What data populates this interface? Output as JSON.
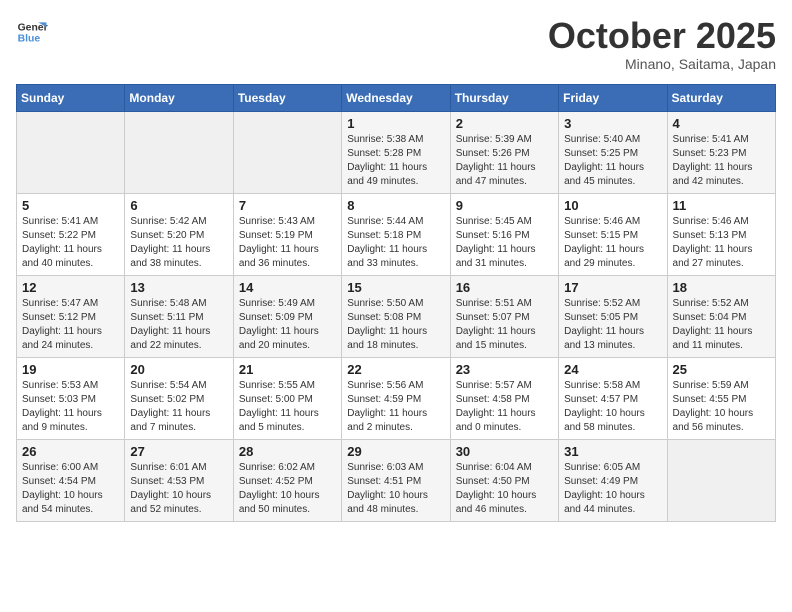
{
  "header": {
    "logo_line1": "General",
    "logo_line2": "Blue",
    "month_title": "October 2025",
    "location": "Minano, Saitama, Japan"
  },
  "weekdays": [
    "Sunday",
    "Monday",
    "Tuesday",
    "Wednesday",
    "Thursday",
    "Friday",
    "Saturday"
  ],
  "weeks": [
    [
      {
        "day": "",
        "info": ""
      },
      {
        "day": "",
        "info": ""
      },
      {
        "day": "",
        "info": ""
      },
      {
        "day": "1",
        "info": "Sunrise: 5:38 AM\nSunset: 5:28 PM\nDaylight: 11 hours\nand 49 minutes."
      },
      {
        "day": "2",
        "info": "Sunrise: 5:39 AM\nSunset: 5:26 PM\nDaylight: 11 hours\nand 47 minutes."
      },
      {
        "day": "3",
        "info": "Sunrise: 5:40 AM\nSunset: 5:25 PM\nDaylight: 11 hours\nand 45 minutes."
      },
      {
        "day": "4",
        "info": "Sunrise: 5:41 AM\nSunset: 5:23 PM\nDaylight: 11 hours\nand 42 minutes."
      }
    ],
    [
      {
        "day": "5",
        "info": "Sunrise: 5:41 AM\nSunset: 5:22 PM\nDaylight: 11 hours\nand 40 minutes."
      },
      {
        "day": "6",
        "info": "Sunrise: 5:42 AM\nSunset: 5:20 PM\nDaylight: 11 hours\nand 38 minutes."
      },
      {
        "day": "7",
        "info": "Sunrise: 5:43 AM\nSunset: 5:19 PM\nDaylight: 11 hours\nand 36 minutes."
      },
      {
        "day": "8",
        "info": "Sunrise: 5:44 AM\nSunset: 5:18 PM\nDaylight: 11 hours\nand 33 minutes."
      },
      {
        "day": "9",
        "info": "Sunrise: 5:45 AM\nSunset: 5:16 PM\nDaylight: 11 hours\nand 31 minutes."
      },
      {
        "day": "10",
        "info": "Sunrise: 5:46 AM\nSunset: 5:15 PM\nDaylight: 11 hours\nand 29 minutes."
      },
      {
        "day": "11",
        "info": "Sunrise: 5:46 AM\nSunset: 5:13 PM\nDaylight: 11 hours\nand 27 minutes."
      }
    ],
    [
      {
        "day": "12",
        "info": "Sunrise: 5:47 AM\nSunset: 5:12 PM\nDaylight: 11 hours\nand 24 minutes."
      },
      {
        "day": "13",
        "info": "Sunrise: 5:48 AM\nSunset: 5:11 PM\nDaylight: 11 hours\nand 22 minutes."
      },
      {
        "day": "14",
        "info": "Sunrise: 5:49 AM\nSunset: 5:09 PM\nDaylight: 11 hours\nand 20 minutes."
      },
      {
        "day": "15",
        "info": "Sunrise: 5:50 AM\nSunset: 5:08 PM\nDaylight: 11 hours\nand 18 minutes."
      },
      {
        "day": "16",
        "info": "Sunrise: 5:51 AM\nSunset: 5:07 PM\nDaylight: 11 hours\nand 15 minutes."
      },
      {
        "day": "17",
        "info": "Sunrise: 5:52 AM\nSunset: 5:05 PM\nDaylight: 11 hours\nand 13 minutes."
      },
      {
        "day": "18",
        "info": "Sunrise: 5:52 AM\nSunset: 5:04 PM\nDaylight: 11 hours\nand 11 minutes."
      }
    ],
    [
      {
        "day": "19",
        "info": "Sunrise: 5:53 AM\nSunset: 5:03 PM\nDaylight: 11 hours\nand 9 minutes."
      },
      {
        "day": "20",
        "info": "Sunrise: 5:54 AM\nSunset: 5:02 PM\nDaylight: 11 hours\nand 7 minutes."
      },
      {
        "day": "21",
        "info": "Sunrise: 5:55 AM\nSunset: 5:00 PM\nDaylight: 11 hours\nand 5 minutes."
      },
      {
        "day": "22",
        "info": "Sunrise: 5:56 AM\nSunset: 4:59 PM\nDaylight: 11 hours\nand 2 minutes."
      },
      {
        "day": "23",
        "info": "Sunrise: 5:57 AM\nSunset: 4:58 PM\nDaylight: 11 hours\nand 0 minutes."
      },
      {
        "day": "24",
        "info": "Sunrise: 5:58 AM\nSunset: 4:57 PM\nDaylight: 10 hours\nand 58 minutes."
      },
      {
        "day": "25",
        "info": "Sunrise: 5:59 AM\nSunset: 4:55 PM\nDaylight: 10 hours\nand 56 minutes."
      }
    ],
    [
      {
        "day": "26",
        "info": "Sunrise: 6:00 AM\nSunset: 4:54 PM\nDaylight: 10 hours\nand 54 minutes."
      },
      {
        "day": "27",
        "info": "Sunrise: 6:01 AM\nSunset: 4:53 PM\nDaylight: 10 hours\nand 52 minutes."
      },
      {
        "day": "28",
        "info": "Sunrise: 6:02 AM\nSunset: 4:52 PM\nDaylight: 10 hours\nand 50 minutes."
      },
      {
        "day": "29",
        "info": "Sunrise: 6:03 AM\nSunset: 4:51 PM\nDaylight: 10 hours\nand 48 minutes."
      },
      {
        "day": "30",
        "info": "Sunrise: 6:04 AM\nSunset: 4:50 PM\nDaylight: 10 hours\nand 46 minutes."
      },
      {
        "day": "31",
        "info": "Sunrise: 6:05 AM\nSunset: 4:49 PM\nDaylight: 10 hours\nand 44 minutes."
      },
      {
        "day": "",
        "info": ""
      }
    ]
  ]
}
